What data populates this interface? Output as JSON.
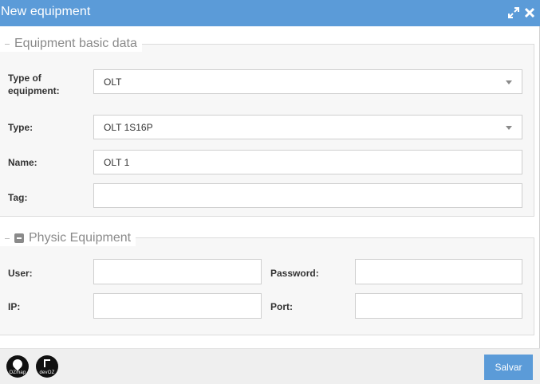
{
  "window": {
    "title": "New equipment",
    "maximize_icon": "maximize-icon",
    "close_icon": "close-icon"
  },
  "basic": {
    "legend": "Equipment basic data",
    "type_of_equipment_label": "Type of equipment:",
    "type_of_equipment_value": "OLT",
    "type_label": "Type:",
    "type_value": "OLT 1S16P",
    "name_label": "Name:",
    "name_value": "OLT 1",
    "tag_label": "Tag:",
    "tag_value": ""
  },
  "physic": {
    "legend": "Physic Equipment",
    "collapse_icon": "minus-square-icon",
    "user_label": "User:",
    "user_value": "",
    "password_label": "Password:",
    "password_value": "",
    "ip_label": "IP:",
    "ip_value": "",
    "port_label": "Port:",
    "port_value": ""
  },
  "footer": {
    "logo1_text": "OZmap",
    "logo2_text": "devOZ",
    "save_label": "Salvar"
  },
  "colors": {
    "titlebar": "#5b9bd8",
    "save_button": "#5b9bd8"
  }
}
